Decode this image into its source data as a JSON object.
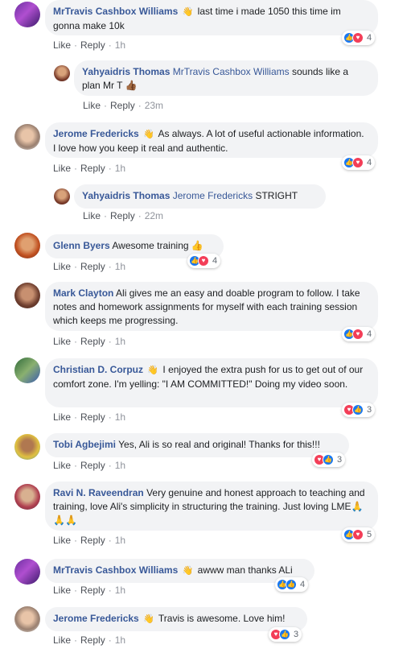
{
  "ui": {
    "like": "Like",
    "reply": "Reply",
    "separator": "·"
  },
  "comments": [
    {
      "name": "MrTravis Cashbox Williams",
      "text": "last time i made 1050 this time im gonna make 10k",
      "time": "1h",
      "reactions": "4"
    },
    {
      "name": "Yahyaidris Thomas",
      "tag": "MrTravis Cashbox Williams",
      "text": "sounds like a plan Mr T",
      "emoji": "👍🏾",
      "time": "23m"
    },
    {
      "name": "Jerome Fredericks",
      "text": "As always. A lot of useful actionable information. I love how you keep it real and authentic.",
      "time": "1h",
      "reactions": "4"
    },
    {
      "name": "Yahyaidris Thomas",
      "tag": "Jerome Fredericks",
      "text": "STRIGHT",
      "time": "22m"
    },
    {
      "name": "Glenn Byers",
      "text": "Awesome training",
      "emoji": "👍",
      "time": "1h",
      "reactions": "4"
    },
    {
      "name": "Mark Clayton",
      "text": "Ali gives me an easy and doable program to follow. I take notes and homework assignments for myself with each training session which keeps me progressing.",
      "time": "1h",
      "reactions": "4"
    },
    {
      "name": "Christian D. Corpuz",
      "text": "I enjoyed the extra push for us to get out of our comfort zone. I'm yelling: \"I AM COMMITTED!\" Doing my video soon.",
      "time": "1h",
      "reactions": "3"
    },
    {
      "name": "Tobi Agbejimi",
      "text": "Yes, Ali is so real and original! Thanks for this!!!",
      "time": "1h",
      "reactions": "3"
    },
    {
      "name": "Ravi N. Raveendran",
      "text": "Very genuine and honest approach to teaching and training, love Ali's simplicity in structuring the training. Just loving LME",
      "emoji": "🙏🙏🙏",
      "time": "1h",
      "reactions": "5"
    },
    {
      "name": "MrTravis Cashbox Williams",
      "text": "awww man thanks ALi",
      "time": "1h",
      "reactions": "4"
    },
    {
      "name": "Jerome Fredericks",
      "text": "Travis is awesome. Love him!",
      "time": "1h",
      "reactions": "3"
    }
  ],
  "icons": {
    "wave": "waving-hand-icon",
    "like": "like-reaction-icon",
    "love": "love-reaction-icon"
  },
  "colors": {
    "name": "#385898",
    "bubble": "#f2f3f5",
    "like": "#1877f2",
    "love": "#f33e58",
    "meta": "#90949c"
  }
}
